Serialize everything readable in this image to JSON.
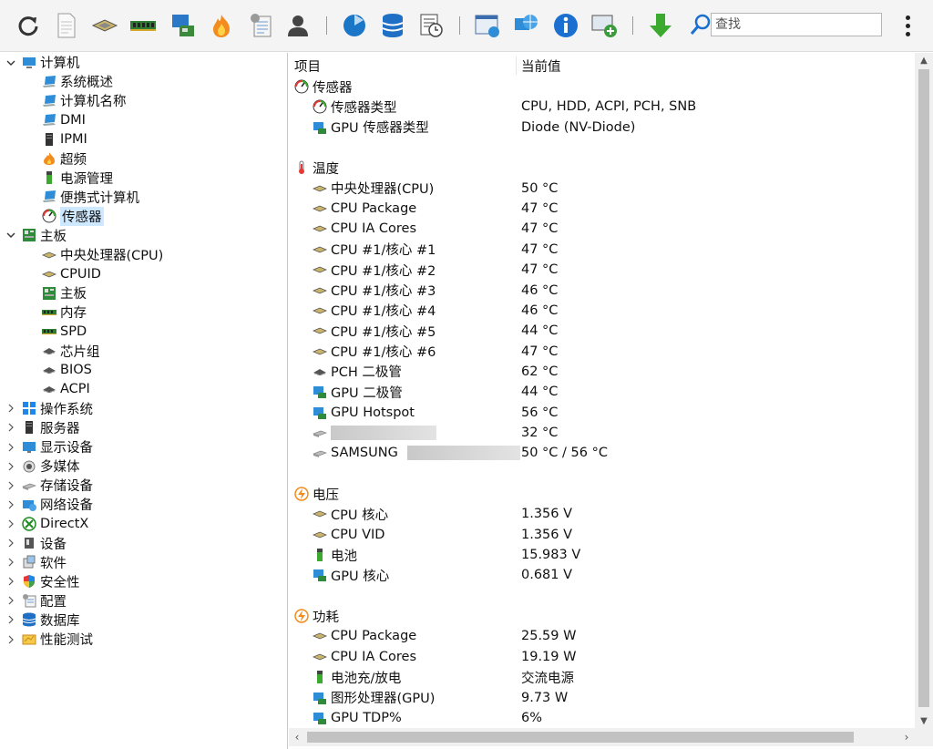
{
  "toolbar": {
    "buttons": [
      "refresh-icon",
      "report-icon",
      "cpu-chip-icon",
      "memory-icon",
      "motherboard-monitor-icon",
      "overclock-flame-icon",
      "config-tool-icon",
      "user-icon",
      "os-globe-icon",
      "database-icon",
      "timer-report-icon",
      "web-report-icon",
      "network-globe-icon",
      "info-icon",
      "remote-icon",
      "download-arrow-icon"
    ],
    "search_placeholder": "查找"
  },
  "tree": [
    {
      "label": "计算机",
      "expanded": true,
      "level": 0,
      "icon": "computer-icon"
    },
    {
      "label": "系统概述",
      "level": 1,
      "icon": "laptop-icon"
    },
    {
      "label": "计算机名称",
      "level": 1,
      "icon": "laptop-icon"
    },
    {
      "label": "DMI",
      "level": 1,
      "icon": "laptop-icon"
    },
    {
      "label": "IPMI",
      "level": 1,
      "icon": "server-icon"
    },
    {
      "label": "超频",
      "level": 1,
      "icon": "flame-icon"
    },
    {
      "label": "电源管理",
      "level": 1,
      "icon": "battery-icon"
    },
    {
      "label": "便携式计算机",
      "level": 1,
      "icon": "laptop-icon"
    },
    {
      "label": "传感器",
      "level": 1,
      "icon": "gauge-icon",
      "selected": true
    },
    {
      "label": "主板",
      "expanded": true,
      "level": 0,
      "icon": "motherboard-icon"
    },
    {
      "label": "中央处理器(CPU)",
      "level": 1,
      "icon": "cpu-chip-icon"
    },
    {
      "label": "CPUID",
      "level": 1,
      "icon": "cpu-chip-icon"
    },
    {
      "label": "主板",
      "level": 1,
      "icon": "motherboard-icon"
    },
    {
      "label": "内存",
      "level": 1,
      "icon": "memory-icon"
    },
    {
      "label": "SPD",
      "level": 1,
      "icon": "memory-icon"
    },
    {
      "label": "芯片组",
      "level": 1,
      "icon": "chipset-icon"
    },
    {
      "label": "BIOS",
      "level": 1,
      "icon": "chipset-icon"
    },
    {
      "label": "ACPI",
      "level": 1,
      "icon": "chipset-icon"
    },
    {
      "label": "操作系统",
      "level": 0,
      "icon": "windows-icon"
    },
    {
      "label": "服务器",
      "level": 0,
      "icon": "server-icon"
    },
    {
      "label": "显示设备",
      "level": 0,
      "icon": "monitor-icon"
    },
    {
      "label": "多媒体",
      "level": 0,
      "icon": "speaker-icon"
    },
    {
      "label": "存储设备",
      "level": 0,
      "icon": "disk-icon"
    },
    {
      "label": "网络设备",
      "level": 0,
      "icon": "network-icon"
    },
    {
      "label": "DirectX",
      "level": 0,
      "icon": "xbox-icon"
    },
    {
      "label": "设备",
      "level": 0,
      "icon": "device-icon"
    },
    {
      "label": "软件",
      "level": 0,
      "icon": "software-icon"
    },
    {
      "label": "安全性",
      "level": 0,
      "icon": "shield-icon"
    },
    {
      "label": "配置",
      "level": 0,
      "icon": "config-icon"
    },
    {
      "label": "数据库",
      "level": 0,
      "icon": "database-icon"
    },
    {
      "label": "性能测试",
      "level": 0,
      "icon": "benchmark-icon"
    }
  ],
  "list": {
    "col_item": "项目",
    "col_value": "当前值",
    "rows": [
      {
        "type": "group",
        "name": "传感器",
        "icon": "gauge-icon"
      },
      {
        "type": "item",
        "name": "传感器类型",
        "value": "CPU, HDD, ACPI, PCH, SNB",
        "icon": "gauge-icon"
      },
      {
        "type": "item",
        "name": "GPU 传感器类型",
        "value": "Diode  (NV-Diode)",
        "icon": "gpu-icon"
      },
      {
        "type": "blank"
      },
      {
        "type": "group",
        "name": "温度",
        "icon": "thermometer-icon"
      },
      {
        "type": "item",
        "name": "中央处理器(CPU)",
        "value": "50 °C",
        "icon": "cpu-chip-icon"
      },
      {
        "type": "item",
        "name": "CPU Package",
        "value": "47 °C",
        "icon": "cpu-chip-icon"
      },
      {
        "type": "item",
        "name": "CPU IA Cores",
        "value": "47 °C",
        "icon": "cpu-chip-icon"
      },
      {
        "type": "item",
        "name": "CPU #1/核心 #1",
        "value": "47 °C",
        "icon": "cpu-chip-icon"
      },
      {
        "type": "item",
        "name": "CPU #1/核心 #2",
        "value": "47 °C",
        "icon": "cpu-chip-icon"
      },
      {
        "type": "item",
        "name": "CPU #1/核心 #3",
        "value": "46 °C",
        "icon": "cpu-chip-icon"
      },
      {
        "type": "item",
        "name": "CPU #1/核心 #4",
        "value": "46 °C",
        "icon": "cpu-chip-icon"
      },
      {
        "type": "item",
        "name": "CPU #1/核心 #5",
        "value": "44 °C",
        "icon": "cpu-chip-icon"
      },
      {
        "type": "item",
        "name": "CPU #1/核心 #6",
        "value": "47 °C",
        "icon": "cpu-chip-icon"
      },
      {
        "type": "item",
        "name": "PCH 二极管",
        "value": "62 °C",
        "icon": "chipset-icon"
      },
      {
        "type": "item",
        "name": "GPU 二极管",
        "value": "44 °C",
        "icon": "gpu-icon"
      },
      {
        "type": "item",
        "name": "GPU Hotspot",
        "value": "56 °C",
        "icon": "gpu-icon"
      },
      {
        "type": "item",
        "name": "",
        "value": "32 °C",
        "icon": "disk-icon",
        "redacted": true
      },
      {
        "type": "item",
        "name": "SAMSUNG",
        "value": "50 °C / 56 °C",
        "icon": "disk-icon",
        "redacted": true
      },
      {
        "type": "blank"
      },
      {
        "type": "group",
        "name": "电压",
        "icon": "voltage-icon"
      },
      {
        "type": "item",
        "name": "CPU 核心",
        "value": "1.356 V",
        "icon": "cpu-chip-icon"
      },
      {
        "type": "item",
        "name": "CPU VID",
        "value": "1.356 V",
        "icon": "cpu-chip-icon"
      },
      {
        "type": "item",
        "name": "电池",
        "value": "15.983 V",
        "icon": "battery-icon"
      },
      {
        "type": "item",
        "name": "GPU 核心",
        "value": "0.681 V",
        "icon": "gpu-icon"
      },
      {
        "type": "blank"
      },
      {
        "type": "group",
        "name": "功耗",
        "icon": "voltage-icon"
      },
      {
        "type": "item",
        "name": "CPU Package",
        "value": "25.59 W",
        "icon": "cpu-chip-icon"
      },
      {
        "type": "item",
        "name": "CPU IA Cores",
        "value": "19.19 W",
        "icon": "cpu-chip-icon"
      },
      {
        "type": "item",
        "name": "电池充/放电",
        "value": "交流电源",
        "icon": "battery-icon"
      },
      {
        "type": "item",
        "name": "图形处理器(GPU)",
        "value": "9.73 W",
        "icon": "gpu-icon"
      },
      {
        "type": "item",
        "name": "GPU TDP%",
        "value": "6%",
        "icon": "gpu-icon"
      }
    ]
  }
}
